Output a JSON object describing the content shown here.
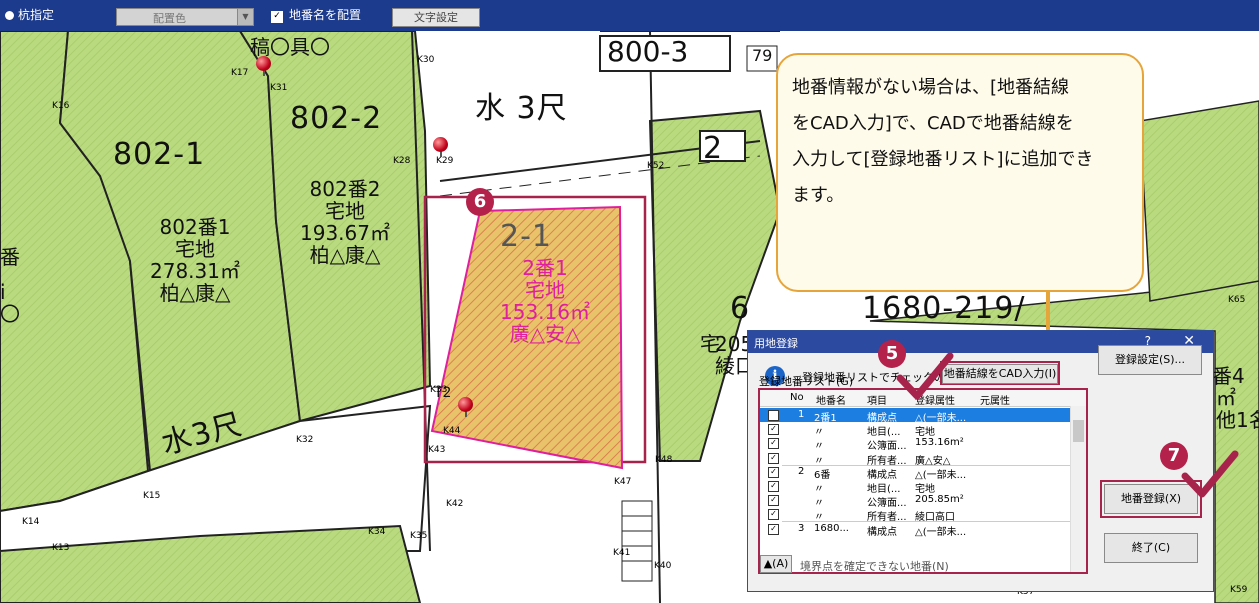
{
  "toolbar": {
    "stake_label": "杭指定",
    "color_combo": "配置色",
    "show_lot_label": "地番名を配置",
    "text_settings": "文字設定"
  },
  "map": {
    "top_labels": [
      "稿〇具〇",
      "800-3",
      "79",
      "802-2",
      "水 3尺",
      "2"
    ],
    "big_labels": [
      "802-1",
      "6",
      "1680-219/",
      "2-1"
    ],
    "parcel1": [
      "802番1",
      "宅地",
      "278.31㎡",
      "柏△康△"
    ],
    "parcel2": [
      "802番2",
      "宅地",
      "193.67㎡",
      "柏△康△"
    ],
    "selected_parcel": [
      "2番1",
      "宅地",
      "153.16㎡",
      "廣△安△"
    ],
    "left_edge": [
      "番",
      "i",
      "〇"
    ],
    "right_edge": [
      "宅",
      "205",
      "綾口",
      "番4",
      "㎡",
      "他1名"
    ],
    "water_label": "水3尺",
    "t2_label": "T2",
    "k_labels": [
      "K17",
      "K31",
      "K30",
      "K16",
      "K28",
      "K29",
      "K52",
      "K65",
      "K33",
      "K32",
      "K44",
      "K43",
      "K15",
      "K42",
      "K47",
      "K48",
      "K14",
      "K13",
      "K34",
      "K35",
      "K41",
      "K40",
      "K57",
      "K59"
    ]
  },
  "badges": [
    "6",
    "5",
    "7"
  ],
  "callout": {
    "lines": [
      "地番情報がない場合は、[地番結線",
      "をCAD入力]で、CADで地番結線を",
      "入力して[登録地番リスト]に追加でき",
      "ます。"
    ]
  },
  "dialog": {
    "title": "用地登録",
    "help": "?",
    "close": "✕",
    "info_icon": "i",
    "info_text": "登録地番リストでチェックのある地番を登録します。",
    "list_label": "登録地番リスト(G)",
    "cad_button": "地番結線をCAD入力(I)",
    "settings_button": "登録設定(S)...",
    "register_button": "地番登録(X)",
    "close_button": "終了(C)",
    "bottom_button": "▲(A)",
    "bottom_text": "境界点を確定できない地番(N)",
    "columns": [
      "No",
      "地番名",
      "項目",
      "登録属性",
      "元属性"
    ],
    "rows": [
      {
        "no": "1",
        "name": "2番1",
        "item": "構成点",
        "attr": "△(一部未...",
        "orig": "",
        "selected": true
      },
      {
        "no": "",
        "name": "〃",
        "item": "地目(...",
        "attr": "宅地",
        "orig": ""
      },
      {
        "no": "",
        "name": "〃",
        "item": "公簿面...",
        "attr": "153.16m²",
        "orig": ""
      },
      {
        "no": "",
        "name": "〃",
        "item": "所有者...",
        "attr": "廣△安△",
        "orig": ""
      },
      {
        "no": "2",
        "name": "6番",
        "item": "構成点",
        "attr": "△(一部未...",
        "orig": ""
      },
      {
        "no": "",
        "name": "〃",
        "item": "地目(...",
        "attr": "宅地",
        "orig": ""
      },
      {
        "no": "",
        "name": "〃",
        "item": "公簿面...",
        "attr": "205.85m²",
        "orig": ""
      },
      {
        "no": "",
        "name": "〃",
        "item": "所有者...",
        "attr": "綾口高口",
        "orig": ""
      },
      {
        "no": "3",
        "name": "1680...",
        "item": "構成点",
        "attr": "△(一部未...",
        "orig": ""
      }
    ]
  },
  "colors": {
    "map_green": "#b5d77a",
    "highlight": "#a8234b",
    "title_bar": "#2b4aa0",
    "toolbar": "#1d3b8c",
    "selected_row": "#1b7ee0",
    "hatch": "#e3bc5e"
  }
}
